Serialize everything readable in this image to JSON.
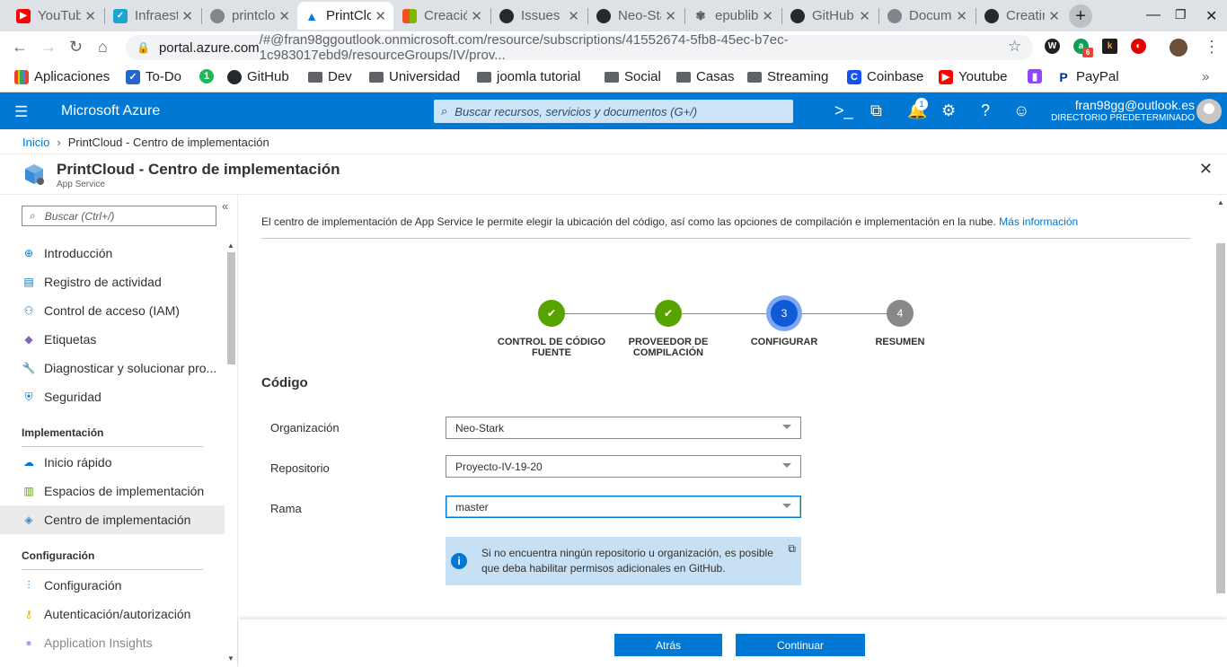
{
  "browser": {
    "tabs": [
      {
        "title": "YouTube",
        "color": "#ff0000",
        "glyph": "▶"
      },
      {
        "title": "Infraestructura",
        "color": "#19a7ce",
        "glyph": "✓"
      },
      {
        "title": "printcloud",
        "color": "#80868b",
        "glyph": "◎"
      },
      {
        "title": "PrintCloud",
        "color": "#0078d4",
        "glyph": "▲"
      },
      {
        "title": "Creación",
        "color": "#f25022",
        "glyph": "▦"
      },
      {
        "title": "Issues",
        "color": "#24292e",
        "glyph": "●"
      },
      {
        "title": "Neo-Stark",
        "color": "#24292e",
        "glyph": "●"
      },
      {
        "title": "epublibre",
        "color": "#5f6368",
        "glyph": "✾"
      },
      {
        "title": "GitHub",
        "color": "#24292e",
        "glyph": "●"
      },
      {
        "title": "Documentación",
        "color": "#80868b",
        "glyph": "◎"
      },
      {
        "title": "Creating",
        "color": "#24292e",
        "glyph": "●"
      }
    ],
    "url_host": "portal.azure.com",
    "url_rest": "/#@fran98ggoutlook.onmicrosoft.com/resource/subscriptions/41552674-5fb8-45ec-b7ec-1c983017ebd9/resourceGroups/IV/prov...",
    "bookmarks": [
      {
        "label": "Aplicaciones",
        "kind": "apps"
      },
      {
        "label": "To-Do",
        "kind": "todo"
      },
      {
        "label": "",
        "kind": "green"
      },
      {
        "label": "GitHub",
        "kind": "github"
      },
      {
        "label": "Dev",
        "kind": "folder"
      },
      {
        "label": "Universidad",
        "kind": "folder"
      },
      {
        "label": "joomla tutorial",
        "kind": "folder"
      },
      {
        "label": "Social",
        "kind": "folder"
      },
      {
        "label": "Casas",
        "kind": "folder"
      },
      {
        "label": "Streaming",
        "kind": "folder"
      },
      {
        "label": "Coinbase",
        "kind": "coinbase"
      },
      {
        "label": "Youtube",
        "kind": "youtube"
      },
      {
        "label": "",
        "kind": "twitch"
      },
      {
        "label": "PayPal",
        "kind": "paypal"
      }
    ],
    "ext_badge": "6"
  },
  "azure": {
    "brand": "Microsoft Azure",
    "search_placeholder": "Buscar recursos, servicios y documentos (G+/)",
    "notifications_count": "1",
    "user_email": "fran98gg@outlook.es",
    "user_directory": "DIRECTORIO PREDETERMINADO"
  },
  "breadcrumb": {
    "home": "Inicio",
    "current": "PrintCloud - Centro de implementación"
  },
  "blade": {
    "title": "PrintCloud - Centro de implementación",
    "subtitle": "App Service"
  },
  "sidebar": {
    "filter_placeholder": "Buscar (Ctrl+/)",
    "items_top": [
      {
        "label": "Introducción",
        "icon": "globe-icon"
      },
      {
        "label": "Registro de actividad",
        "icon": "log-icon"
      },
      {
        "label": "Control de acceso (IAM)",
        "icon": "people-icon"
      },
      {
        "label": "Etiquetas",
        "icon": "tag-icon"
      },
      {
        "label": "Diagnosticar y solucionar pro...",
        "icon": "wrench-icon"
      },
      {
        "label": "Seguridad",
        "icon": "shield-icon"
      }
    ],
    "section_impl": "Implementación",
    "items_impl": [
      {
        "label": "Inicio rápido",
        "icon": "cloud-icon"
      },
      {
        "label": "Espacios de implementación",
        "icon": "bars-icon"
      },
      {
        "label": "Centro de implementación",
        "icon": "deploy-icon"
      }
    ],
    "section_config": "Configuración",
    "items_config": [
      {
        "label": "Configuración",
        "icon": "sliders-icon"
      },
      {
        "label": "Autenticación/autorización",
        "icon": "key-icon"
      },
      {
        "label": "Application Insights",
        "icon": "bulb-icon"
      }
    ]
  },
  "main": {
    "description": "El centro de implementación de App Service le permite elegir la ubicación del código, así como las opciones de compilación e implementación en la nube.",
    "more_info": "Más información",
    "steps": [
      {
        "label": "CONTROL DE CÓDIGO FUENTE",
        "state": "done",
        "num": "1"
      },
      {
        "label": "PROVEEDOR DE COMPILACIÓN",
        "state": "done",
        "num": "2"
      },
      {
        "label": "CONFIGURAR",
        "state": "current",
        "num": "3"
      },
      {
        "label": "RESUMEN",
        "state": "todo",
        "num": "4"
      }
    ],
    "section_title": "Código",
    "fields": {
      "org_label": "Organización",
      "org_value": "Neo-Stark",
      "repo_label": "Repositorio",
      "repo_value": "Proyecto-IV-19-20",
      "branch_label": "Rama",
      "branch_value": "master"
    },
    "info_text": "Si no encuentra ningún repositorio u organización, es posible que deba habilitar permisos adicionales en GitHub."
  },
  "footer": {
    "back": "Atrás",
    "continue": "Continuar"
  },
  "colors": {
    "azure_blue": "#0078d4",
    "step_done": "#57a300",
    "step_current": "#0f5ad6"
  }
}
